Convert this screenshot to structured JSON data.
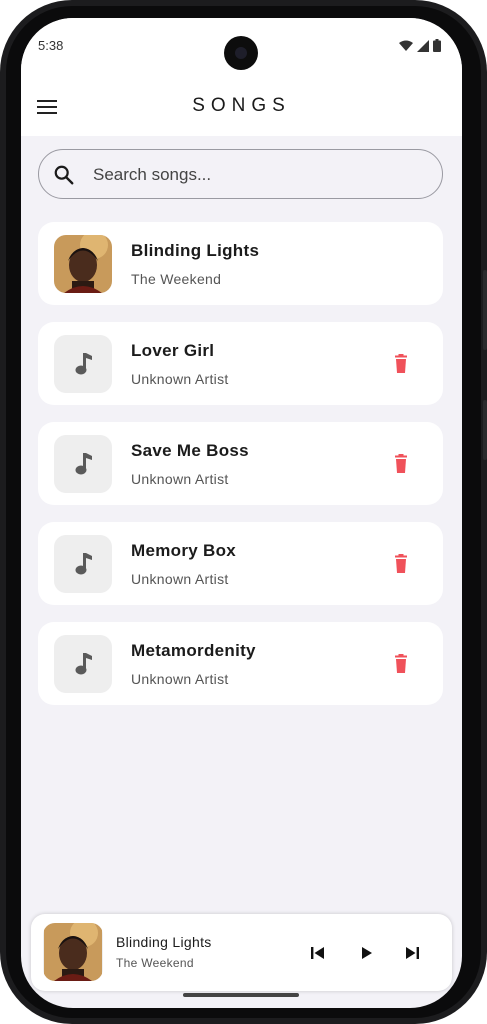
{
  "status_bar": {
    "time": "5:38",
    "icons": [
      "wifi-icon",
      "signal-icon",
      "battery-icon"
    ]
  },
  "header": {
    "title": "SONGS",
    "menu_icon": "menu-icon"
  },
  "search": {
    "placeholder": "Search songs...",
    "value": "",
    "icon": "search-icon"
  },
  "songs": [
    {
      "title": "Blinding Lights",
      "artist": "The Weekend",
      "artwork": "album-art",
      "deletable": false
    },
    {
      "title": "Lover Girl",
      "artist": "Unknown Artist",
      "artwork": "music-note-icon",
      "deletable": true
    },
    {
      "title": "Save Me Boss",
      "artist": "Unknown Artist",
      "artwork": "music-note-icon",
      "deletable": true
    },
    {
      "title": "Memory Box",
      "artist": "Unknown Artist",
      "artwork": "music-note-icon",
      "deletable": true
    },
    {
      "title": "Metamordenity",
      "artist": "Unknown Artist",
      "artwork": "music-note-icon",
      "deletable": true
    }
  ],
  "now_playing": {
    "title": "Blinding Lights",
    "artist": "The Weekend",
    "controls": [
      "skip-previous-icon",
      "play-icon",
      "skip-next-icon"
    ]
  },
  "colors": {
    "background": "#f3f2f7",
    "card": "#ffffff",
    "delete": "#f0515a",
    "icon_dark": "#5a5a5a"
  }
}
